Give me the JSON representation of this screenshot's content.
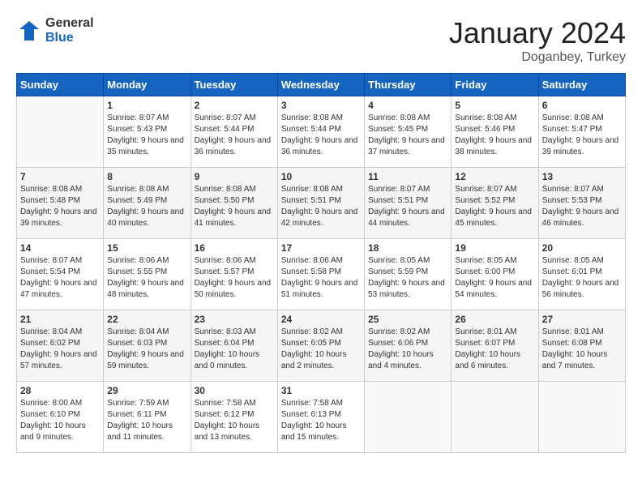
{
  "header": {
    "logo_general": "General",
    "logo_blue": "Blue",
    "month_title": "January 2024",
    "location": "Doganbey, Turkey"
  },
  "calendar": {
    "weekdays": [
      "Sunday",
      "Monday",
      "Tuesday",
      "Wednesday",
      "Thursday",
      "Friday",
      "Saturday"
    ],
    "weeks": [
      [
        {
          "day": "",
          "sunrise": "",
          "sunset": "",
          "daylight": ""
        },
        {
          "day": "1",
          "sunrise": "Sunrise: 8:07 AM",
          "sunset": "Sunset: 5:43 PM",
          "daylight": "Daylight: 9 hours and 35 minutes."
        },
        {
          "day": "2",
          "sunrise": "Sunrise: 8:07 AM",
          "sunset": "Sunset: 5:44 PM",
          "daylight": "Daylight: 9 hours and 36 minutes."
        },
        {
          "day": "3",
          "sunrise": "Sunrise: 8:08 AM",
          "sunset": "Sunset: 5:44 PM",
          "daylight": "Daylight: 9 hours and 36 minutes."
        },
        {
          "day": "4",
          "sunrise": "Sunrise: 8:08 AM",
          "sunset": "Sunset: 5:45 PM",
          "daylight": "Daylight: 9 hours and 37 minutes."
        },
        {
          "day": "5",
          "sunrise": "Sunrise: 8:08 AM",
          "sunset": "Sunset: 5:46 PM",
          "daylight": "Daylight: 9 hours and 38 minutes."
        },
        {
          "day": "6",
          "sunrise": "Sunrise: 8:08 AM",
          "sunset": "Sunset: 5:47 PM",
          "daylight": "Daylight: 9 hours and 39 minutes."
        }
      ],
      [
        {
          "day": "7",
          "sunrise": "Sunrise: 8:08 AM",
          "sunset": "Sunset: 5:48 PM",
          "daylight": "Daylight: 9 hours and 39 minutes."
        },
        {
          "day": "8",
          "sunrise": "Sunrise: 8:08 AM",
          "sunset": "Sunset: 5:49 PM",
          "daylight": "Daylight: 9 hours and 40 minutes."
        },
        {
          "day": "9",
          "sunrise": "Sunrise: 8:08 AM",
          "sunset": "Sunset: 5:50 PM",
          "daylight": "Daylight: 9 hours and 41 minutes."
        },
        {
          "day": "10",
          "sunrise": "Sunrise: 8:08 AM",
          "sunset": "Sunset: 5:51 PM",
          "daylight": "Daylight: 9 hours and 42 minutes."
        },
        {
          "day": "11",
          "sunrise": "Sunrise: 8:07 AM",
          "sunset": "Sunset: 5:51 PM",
          "daylight": "Daylight: 9 hours and 44 minutes."
        },
        {
          "day": "12",
          "sunrise": "Sunrise: 8:07 AM",
          "sunset": "Sunset: 5:52 PM",
          "daylight": "Daylight: 9 hours and 45 minutes."
        },
        {
          "day": "13",
          "sunrise": "Sunrise: 8:07 AM",
          "sunset": "Sunset: 5:53 PM",
          "daylight": "Daylight: 9 hours and 46 minutes."
        }
      ],
      [
        {
          "day": "14",
          "sunrise": "Sunrise: 8:07 AM",
          "sunset": "Sunset: 5:54 PM",
          "daylight": "Daylight: 9 hours and 47 minutes."
        },
        {
          "day": "15",
          "sunrise": "Sunrise: 8:06 AM",
          "sunset": "Sunset: 5:55 PM",
          "daylight": "Daylight: 9 hours and 48 minutes."
        },
        {
          "day": "16",
          "sunrise": "Sunrise: 8:06 AM",
          "sunset": "Sunset: 5:57 PM",
          "daylight": "Daylight: 9 hours and 50 minutes."
        },
        {
          "day": "17",
          "sunrise": "Sunrise: 8:06 AM",
          "sunset": "Sunset: 5:58 PM",
          "daylight": "Daylight: 9 hours and 51 minutes."
        },
        {
          "day": "18",
          "sunrise": "Sunrise: 8:05 AM",
          "sunset": "Sunset: 5:59 PM",
          "daylight": "Daylight: 9 hours and 53 minutes."
        },
        {
          "day": "19",
          "sunrise": "Sunrise: 8:05 AM",
          "sunset": "Sunset: 6:00 PM",
          "daylight": "Daylight: 9 hours and 54 minutes."
        },
        {
          "day": "20",
          "sunrise": "Sunrise: 8:05 AM",
          "sunset": "Sunset: 6:01 PM",
          "daylight": "Daylight: 9 hours and 56 minutes."
        }
      ],
      [
        {
          "day": "21",
          "sunrise": "Sunrise: 8:04 AM",
          "sunset": "Sunset: 6:02 PM",
          "daylight": "Daylight: 9 hours and 57 minutes."
        },
        {
          "day": "22",
          "sunrise": "Sunrise: 8:04 AM",
          "sunset": "Sunset: 6:03 PM",
          "daylight": "Daylight: 9 hours and 59 minutes."
        },
        {
          "day": "23",
          "sunrise": "Sunrise: 8:03 AM",
          "sunset": "Sunset: 6:04 PM",
          "daylight": "Daylight: 10 hours and 0 minutes."
        },
        {
          "day": "24",
          "sunrise": "Sunrise: 8:02 AM",
          "sunset": "Sunset: 6:05 PM",
          "daylight": "Daylight: 10 hours and 2 minutes."
        },
        {
          "day": "25",
          "sunrise": "Sunrise: 8:02 AM",
          "sunset": "Sunset: 6:06 PM",
          "daylight": "Daylight: 10 hours and 4 minutes."
        },
        {
          "day": "26",
          "sunrise": "Sunrise: 8:01 AM",
          "sunset": "Sunset: 6:07 PM",
          "daylight": "Daylight: 10 hours and 6 minutes."
        },
        {
          "day": "27",
          "sunrise": "Sunrise: 8:01 AM",
          "sunset": "Sunset: 6:08 PM",
          "daylight": "Daylight: 10 hours and 7 minutes."
        }
      ],
      [
        {
          "day": "28",
          "sunrise": "Sunrise: 8:00 AM",
          "sunset": "Sunset: 6:10 PM",
          "daylight": "Daylight: 10 hours and 9 minutes."
        },
        {
          "day": "29",
          "sunrise": "Sunrise: 7:59 AM",
          "sunset": "Sunset: 6:11 PM",
          "daylight": "Daylight: 10 hours and 11 minutes."
        },
        {
          "day": "30",
          "sunrise": "Sunrise: 7:58 AM",
          "sunset": "Sunset: 6:12 PM",
          "daylight": "Daylight: 10 hours and 13 minutes."
        },
        {
          "day": "31",
          "sunrise": "Sunrise: 7:58 AM",
          "sunset": "Sunset: 6:13 PM",
          "daylight": "Daylight: 10 hours and 15 minutes."
        },
        {
          "day": "",
          "sunrise": "",
          "sunset": "",
          "daylight": ""
        },
        {
          "day": "",
          "sunrise": "",
          "sunset": "",
          "daylight": ""
        },
        {
          "day": "",
          "sunrise": "",
          "sunset": "",
          "daylight": ""
        }
      ]
    ]
  }
}
